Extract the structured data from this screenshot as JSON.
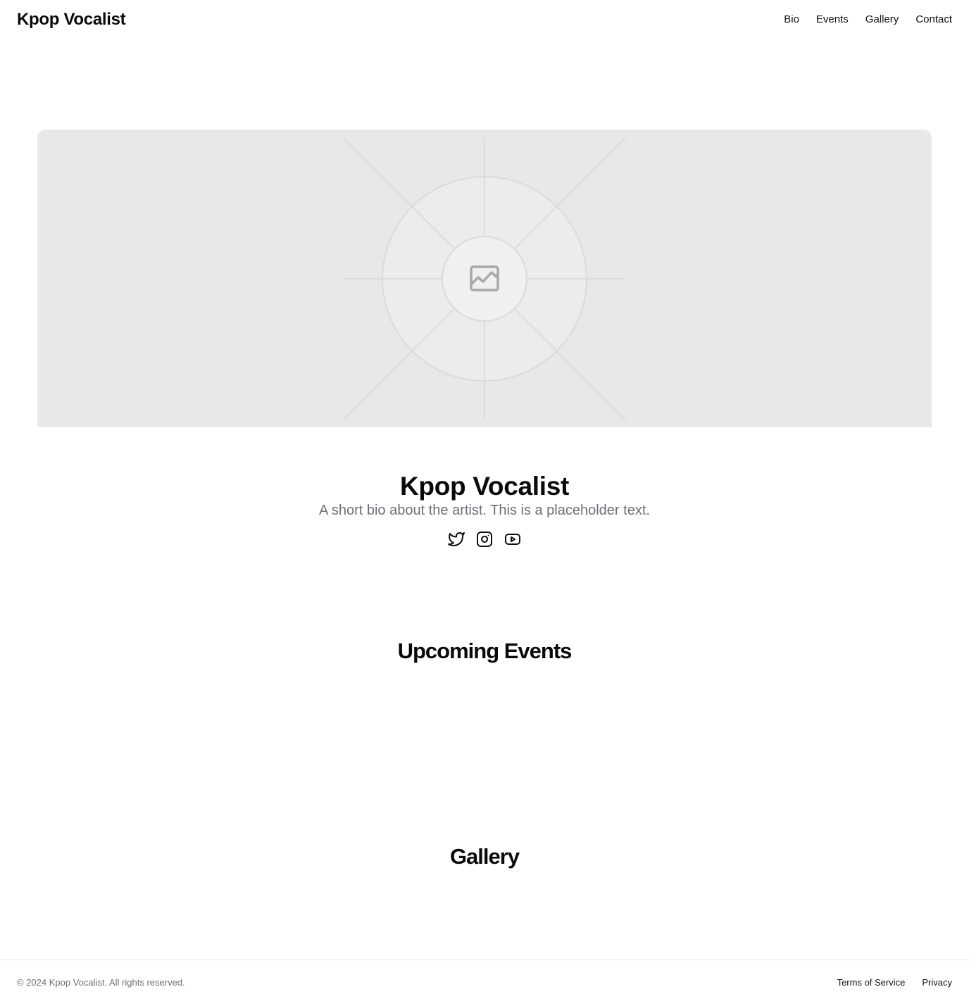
{
  "header": {
    "brand": "Kpop Vocalist",
    "nav": [
      "Bio",
      "Events",
      "Gallery",
      "Contact"
    ]
  },
  "hero": {
    "image_icon": "image-placeholder-icon",
    "name": "Kpop Vocalist",
    "bio": "A short bio about the artist. This is a placeholder text.",
    "social_icons": [
      "twitter-icon",
      "instagram-icon",
      "youtube-icon"
    ]
  },
  "sections": {
    "events_title": "Upcoming Events",
    "gallery_title": "Gallery"
  },
  "footer": {
    "copyright": "© 2024 Kpop Vocalist. All rights reserved.",
    "links": [
      "Terms of Service",
      "Privacy"
    ]
  },
  "colors": {
    "text": "#0a0a0a",
    "muted": "#6b6f76",
    "placeholder_bg": "#e8e8e8",
    "border": "#e5e5e5"
  }
}
